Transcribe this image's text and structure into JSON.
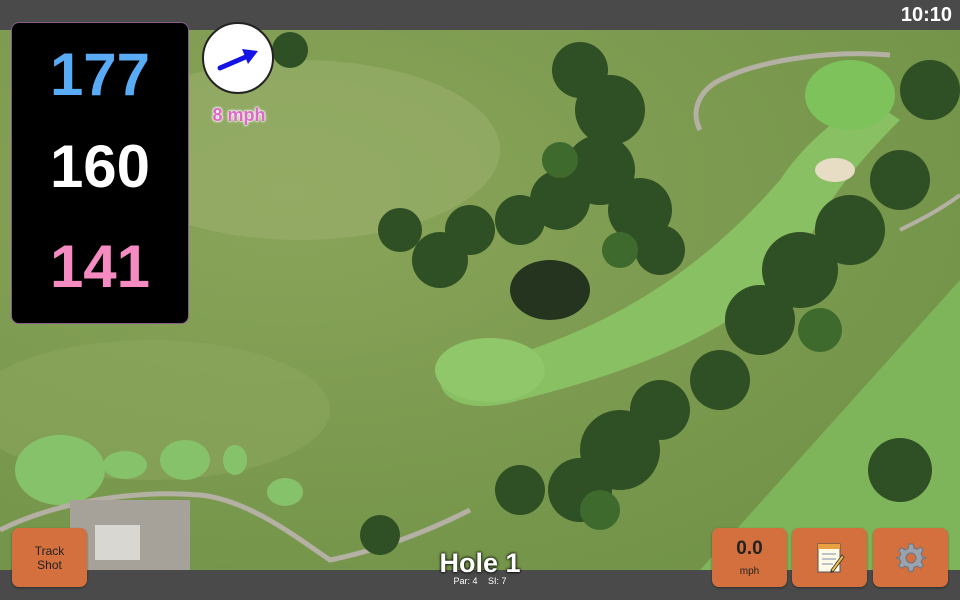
{
  "status_bar": {
    "time": "10:10"
  },
  "distances": {
    "back": "177",
    "center": "160",
    "front": "141"
  },
  "colors": {
    "back": "#5aabf6",
    "center": "#ffffff",
    "front": "#f58bc0",
    "button": "#d4703e",
    "wind": "#e066c8",
    "arrow": "#1414e6"
  },
  "wind": {
    "label": "8 mph",
    "icon": "wind-direction-arrow"
  },
  "hole": {
    "title": "Hole 1",
    "par": "Par: 4",
    "stroke_index": "SI: 7"
  },
  "buttons": {
    "track_shot_line1": "Track",
    "track_shot_line2": "Shot",
    "speed_value": "0.0",
    "speed_unit": "mph",
    "notes_icon": "notepad-icon",
    "settings_icon": "gear-icon"
  }
}
